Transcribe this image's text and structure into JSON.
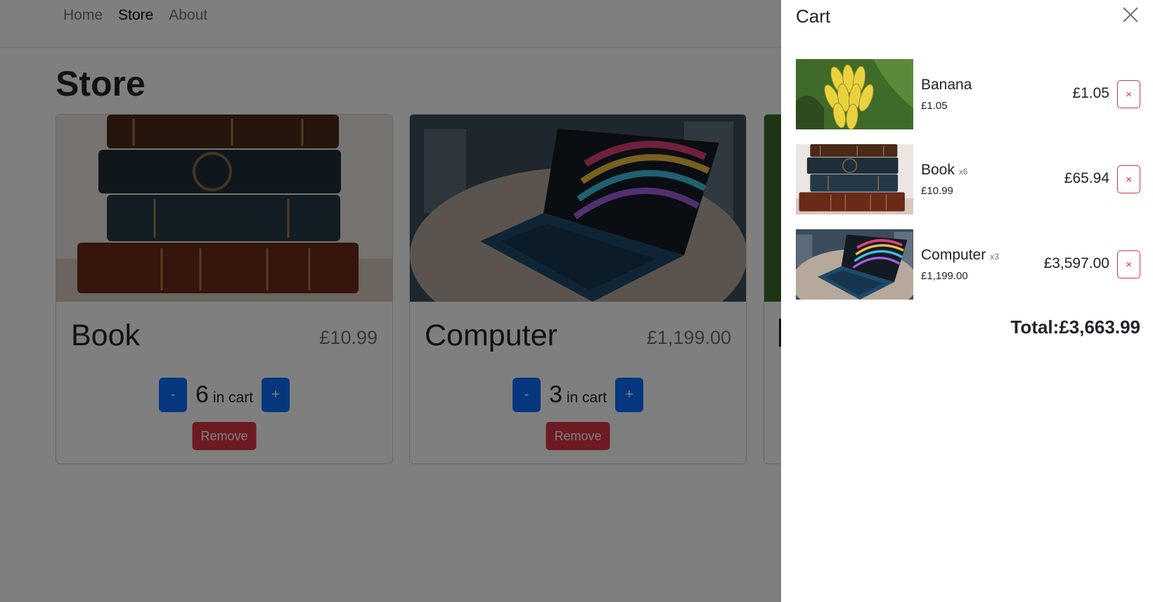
{
  "nav": {
    "links": [
      {
        "label": "Home",
        "active": false
      },
      {
        "label": "Store",
        "active": true
      },
      {
        "label": "About",
        "active": false
      }
    ]
  },
  "page": {
    "title": "Store"
  },
  "products": [
    {
      "name": "Book",
      "price": "£10.99",
      "quantity": "6",
      "in_cart_label": "in cart",
      "minus_label": "-",
      "plus_label": "+",
      "remove_label": "Remove"
    },
    {
      "name": "Computer",
      "price": "£1,199.00",
      "quantity": "3",
      "in_cart_label": "in cart",
      "minus_label": "-",
      "plus_label": "+",
      "remove_label": "Remove"
    }
  ],
  "cart": {
    "title": "Cart",
    "items": [
      {
        "name": "Banana",
        "qty_label": "",
        "unit_price": "£1.05",
        "total": "£1.05",
        "remove_label": "×"
      },
      {
        "name": "Book",
        "qty_label": "x6",
        "unit_price": "£10.99",
        "total": "£65.94",
        "remove_label": "×"
      },
      {
        "name": "Computer",
        "qty_label": "x3",
        "unit_price": "£1,199.00",
        "total": "£3,597.00",
        "remove_label": "×"
      }
    ],
    "total_label": "Total:",
    "total_value": "£3,663.99"
  },
  "colors": {
    "primary": "#0d6efd",
    "danger": "#dc3545",
    "backdrop": "rgba(0,0,0,0.5)"
  }
}
